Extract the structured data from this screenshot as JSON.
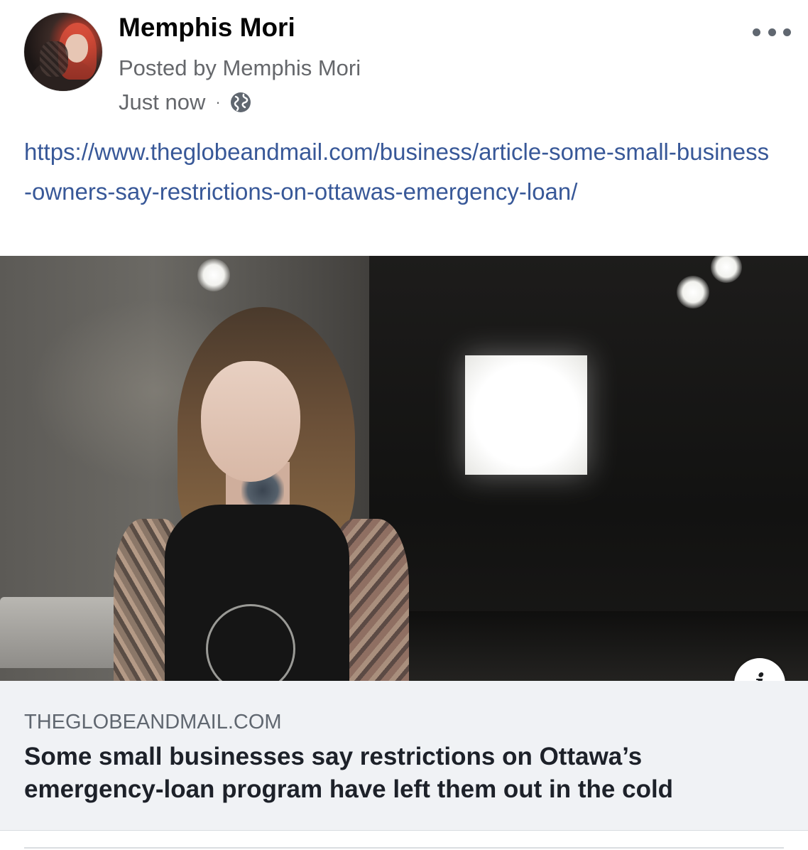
{
  "post": {
    "author_name": "Memphis Mori",
    "posted_by": "Posted by Memphis Mori",
    "timestamp": "Just now",
    "separator": "·",
    "privacy_icon": "globe-icon",
    "more_icon": "more-options-icon",
    "link_text": "https://www.theglobeandmail.com/business/article-some-small-business-owners-say-restrictions-on-ottawas-emergency-loan/"
  },
  "link_preview": {
    "domain": "THEGLOBEANDMAIL.COM",
    "title": "Some small businesses say restrictions on Ottawa’s emergency-loan program have left them out in the cold",
    "info_glyph": "i"
  },
  "colors": {
    "link": "#385898",
    "secondary_text": "#65676b",
    "caption_background": "#f0f2f5"
  }
}
